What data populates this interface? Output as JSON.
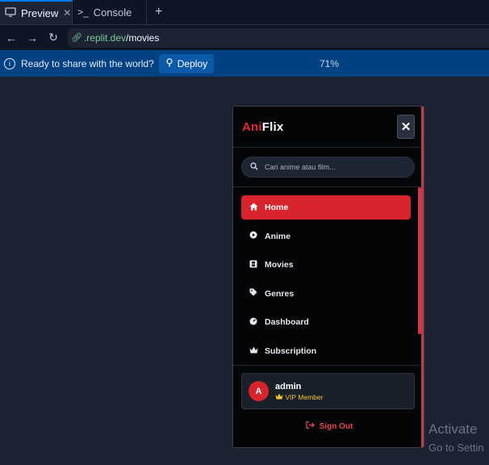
{
  "tabs": [
    {
      "label": "Preview",
      "icon": "monitor-icon",
      "active": true
    },
    {
      "label": "Console",
      "icon": "terminal-icon",
      "active": false
    }
  ],
  "urlbar": {
    "host": ".replit.dev",
    "path": "/movies"
  },
  "deploybar": {
    "message": "Ready to share with the world?",
    "deploy_label": "Deploy",
    "zoom": "71%"
  },
  "app": {
    "brand_prefix": "Ani",
    "brand_suffix": "Flix",
    "brand_color": "#e02a35",
    "search_placeholder": "Cari anime atau film...",
    "nav": [
      {
        "label": "Home",
        "icon": "home-icon",
        "active": true
      },
      {
        "label": "Anime",
        "icon": "play-circle-icon",
        "active": false
      },
      {
        "label": "Movies",
        "icon": "film-icon",
        "active": false
      },
      {
        "label": "Genres",
        "icon": "tag-icon",
        "active": false
      },
      {
        "label": "Dashboard",
        "icon": "gauge-icon",
        "active": false
      },
      {
        "label": "Subscription",
        "icon": "crown-icon",
        "active": false
      }
    ],
    "user": {
      "avatar_initial": "A",
      "name": "admin",
      "badge": "VIP Member",
      "badge_color": "#f2c230"
    },
    "signout_label": "Sign Out"
  },
  "watermark": {
    "line1": "Activate",
    "line2": "Go to Settin"
  }
}
